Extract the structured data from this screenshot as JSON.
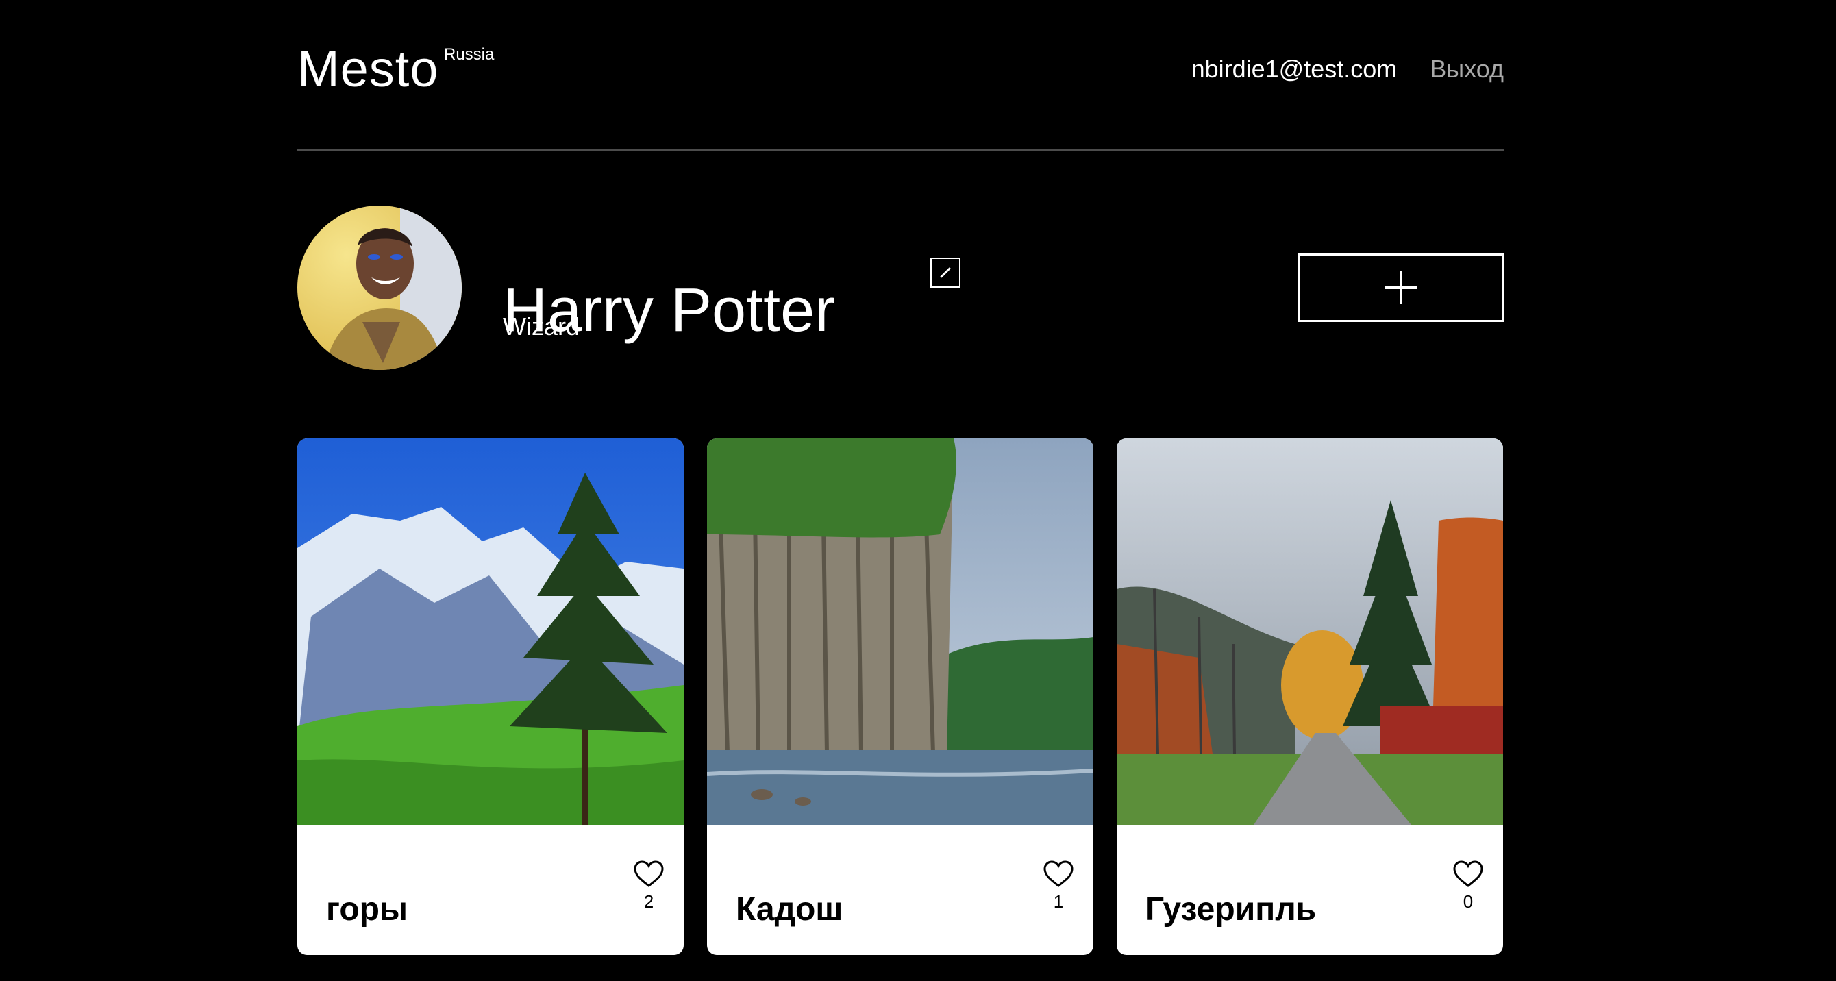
{
  "header": {
    "logo": "Mesto",
    "logo_sup": "Russia",
    "email": "nbirdie1@test.com",
    "logout": "Выход"
  },
  "profile": {
    "name": "Harry Potter",
    "about": "Wizard"
  },
  "cards": [
    {
      "title": "горы",
      "likes": "2"
    },
    {
      "title": "Кадош",
      "likes": "1"
    },
    {
      "title": "Гузерипль",
      "likes": "0"
    }
  ],
  "colors": {
    "background": "#000000",
    "text": "#ffffff",
    "muted": "#a9a9a9",
    "card": "#ffffff"
  },
  "icons": [
    "edit-pencil-icon",
    "plus-icon",
    "heart-icon"
  ]
}
